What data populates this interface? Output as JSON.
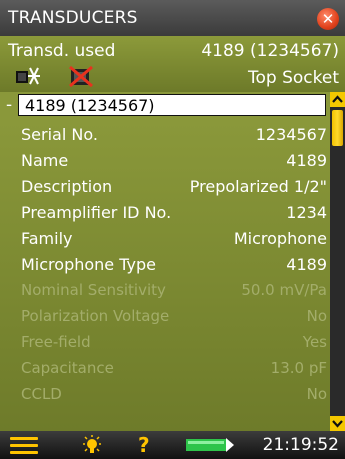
{
  "window": {
    "title": "TRANSDUCERS",
    "close_icon": "close-icon"
  },
  "header": {
    "transducer_used_label": "Transd. used",
    "transducer_used_value": "4189 (1234567)",
    "socket_value": "Top Socket",
    "icons": [
      "transducer-icon",
      "transducer-disabled-icon"
    ]
  },
  "tree": {
    "expander": "-",
    "selected_label": "4189 (1234567)"
  },
  "properties": [
    {
      "label": "Serial No.",
      "value": "1234567",
      "enabled": true
    },
    {
      "label": "Name",
      "value": "4189",
      "enabled": true
    },
    {
      "label": "Description",
      "value": "Prepolarized 1/2\"",
      "enabled": true
    },
    {
      "label": "Preamplifier ID No.",
      "value": "1234",
      "enabled": true
    },
    {
      "label": "Family",
      "value": "Microphone",
      "enabled": true
    },
    {
      "label": "Microphone Type",
      "value": "4189",
      "enabled": true
    },
    {
      "label": "Nominal Sensitivity",
      "value": "50.0 mV/Pa",
      "enabled": false
    },
    {
      "label": "Polarization Voltage",
      "value": "No",
      "enabled": false
    },
    {
      "label": "Free-field",
      "value": "Yes",
      "enabled": false
    },
    {
      "label": "Capacitance",
      "value": "13.0 pF",
      "enabled": false
    },
    {
      "label": "CCLD",
      "value": "No",
      "enabled": false
    }
  ],
  "statusbar": {
    "help_label": "?",
    "time": "21:19:52",
    "icons": [
      "menu-icon",
      "backlight-icon",
      "help-icon",
      "battery-icon"
    ]
  },
  "colors": {
    "panel_green": "#7d8b33",
    "accent_yellow": "#ffc400",
    "close_red": "#e0411b",
    "disabled_text": "#a3ad6a"
  }
}
